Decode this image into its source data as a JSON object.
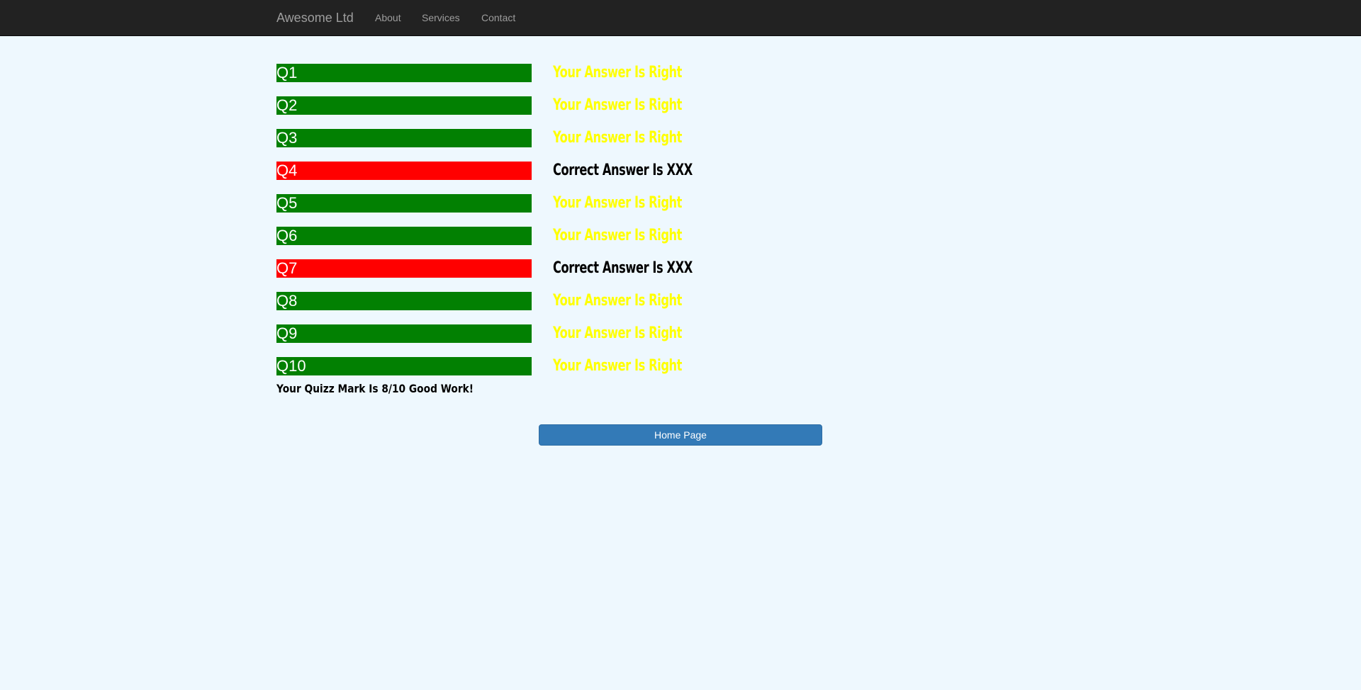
{
  "navbar": {
    "brand": "Awesome Ltd",
    "links": [
      "About",
      "Services",
      "Contact"
    ]
  },
  "results": [
    {
      "label": "Q1",
      "status": "right",
      "message": "Your Answer Is Right"
    },
    {
      "label": "Q2",
      "status": "right",
      "message": "Your Answer Is Right"
    },
    {
      "label": "Q3",
      "status": "right",
      "message": "Your Answer Is Right"
    },
    {
      "label": "Q4",
      "status": "wrong",
      "message": "Correct Answer Is XXX"
    },
    {
      "label": "Q5",
      "status": "right",
      "message": "Your Answer Is Right"
    },
    {
      "label": "Q6",
      "status": "right",
      "message": "Your Answer Is Right"
    },
    {
      "label": "Q7",
      "status": "wrong",
      "message": "Correct Answer Is XXX"
    },
    {
      "label": "Q8",
      "status": "right",
      "message": "Your Answer Is Right"
    },
    {
      "label": "Q9",
      "status": "right",
      "message": "Your Answer Is Right"
    },
    {
      "label": "Q10",
      "status": "right",
      "message": "Your Answer Is Right"
    }
  ],
  "summary": "Your Quizz Mark Is 8/10 Good Work!",
  "home_button": "Home Page",
  "colors": {
    "right_bar": "#028002",
    "wrong_bar": "#ff0000",
    "right_text": "#ffff00",
    "wrong_text": "#000000",
    "navbar": "#222222",
    "background": "#eef8fe",
    "button": "#337ab7"
  }
}
